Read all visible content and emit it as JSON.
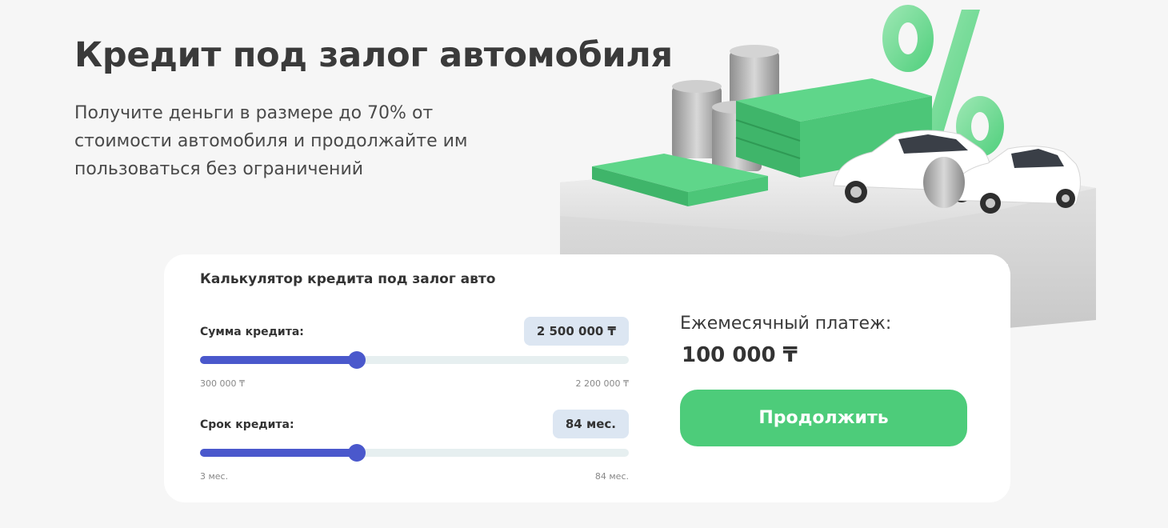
{
  "hero": {
    "title": "Кредит под залог автомобиля",
    "subtitle": "Получите деньги в размере до 70% от стоимости автомобиля и продолжайте им пользоваться без ограничений"
  },
  "illustration": {
    "icon": "car-loan-money-percent-illustration",
    "percent_symbol": "%"
  },
  "calculator": {
    "title": "Калькулятор кредита под залог авто",
    "amount": {
      "label": "Сумма кредита:",
      "value": "2 500 000 ₸",
      "min_label": "300 000 ₸",
      "max_label": "2 200 000 ₸",
      "fill_fraction": 0.365
    },
    "term": {
      "label": "Срок кредита:",
      "value": "84 мес.",
      "min_label": "3 мес.",
      "max_label": "84 мес.",
      "fill_fraction": 0.365
    },
    "payment": {
      "label": "Ежемесячный платеж:",
      "value": "100 000 ₸"
    },
    "continue_label": "Продолжить"
  },
  "colors": {
    "accent_green": "#4dcc7a",
    "slider_blue": "#4a58cc",
    "chip_bg": "#dce6f2",
    "background": "#f6f6f6"
  }
}
